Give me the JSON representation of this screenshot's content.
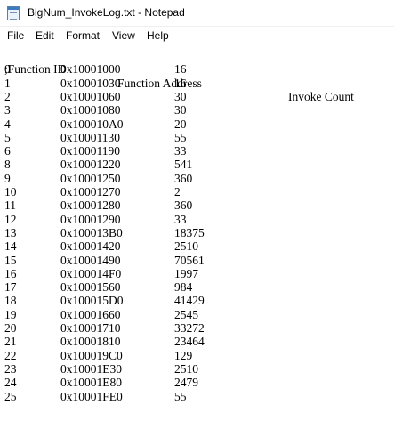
{
  "window": {
    "title": "BigNum_InvokeLog.txt - Notepad",
    "icon": "notepad-icon"
  },
  "menu": [
    "File",
    "Edit",
    "Format",
    "View",
    "Help"
  ],
  "header": {
    "col1": ";Function ID",
    "col2": "Function Address",
    "col3": "Invoke Count"
  },
  "rows": [
    [
      "0",
      "0x10001000",
      "16"
    ],
    [
      "1",
      "0x10001030",
      "16"
    ],
    [
      "2",
      "0x10001060",
      "30"
    ],
    [
      "3",
      "0x10001080",
      "30"
    ],
    [
      "4",
      "0x100010A0",
      "20"
    ],
    [
      "5",
      "0x10001130",
      "55"
    ],
    [
      "6",
      "0x10001190",
      "33"
    ],
    [
      "8",
      "0x10001220",
      "541"
    ],
    [
      "9",
      "0x10001250",
      "360"
    ],
    [
      "10",
      "0x10001270",
      "2"
    ],
    [
      "11",
      "0x10001280",
      "360"
    ],
    [
      "12",
      "0x10001290",
      "33"
    ],
    [
      "13",
      "0x100013B0",
      "18375"
    ],
    [
      "14",
      "0x10001420",
      "2510"
    ],
    [
      "15",
      "0x10001490",
      "70561"
    ],
    [
      "16",
      "0x100014F0",
      "1997"
    ],
    [
      "17",
      "0x10001560",
      "984"
    ],
    [
      "18",
      "0x100015D0",
      "41429"
    ],
    [
      "19",
      "0x10001660",
      "2545"
    ],
    [
      "20",
      "0x10001710",
      "33272"
    ],
    [
      "21",
      "0x10001810",
      "23464"
    ],
    [
      "22",
      "0x100019C0",
      "129"
    ],
    [
      "23",
      "0x10001E30",
      "2510"
    ],
    [
      "24",
      "0x10001E80",
      "2479"
    ],
    [
      "25",
      "0x10001FE0",
      "55"
    ]
  ]
}
